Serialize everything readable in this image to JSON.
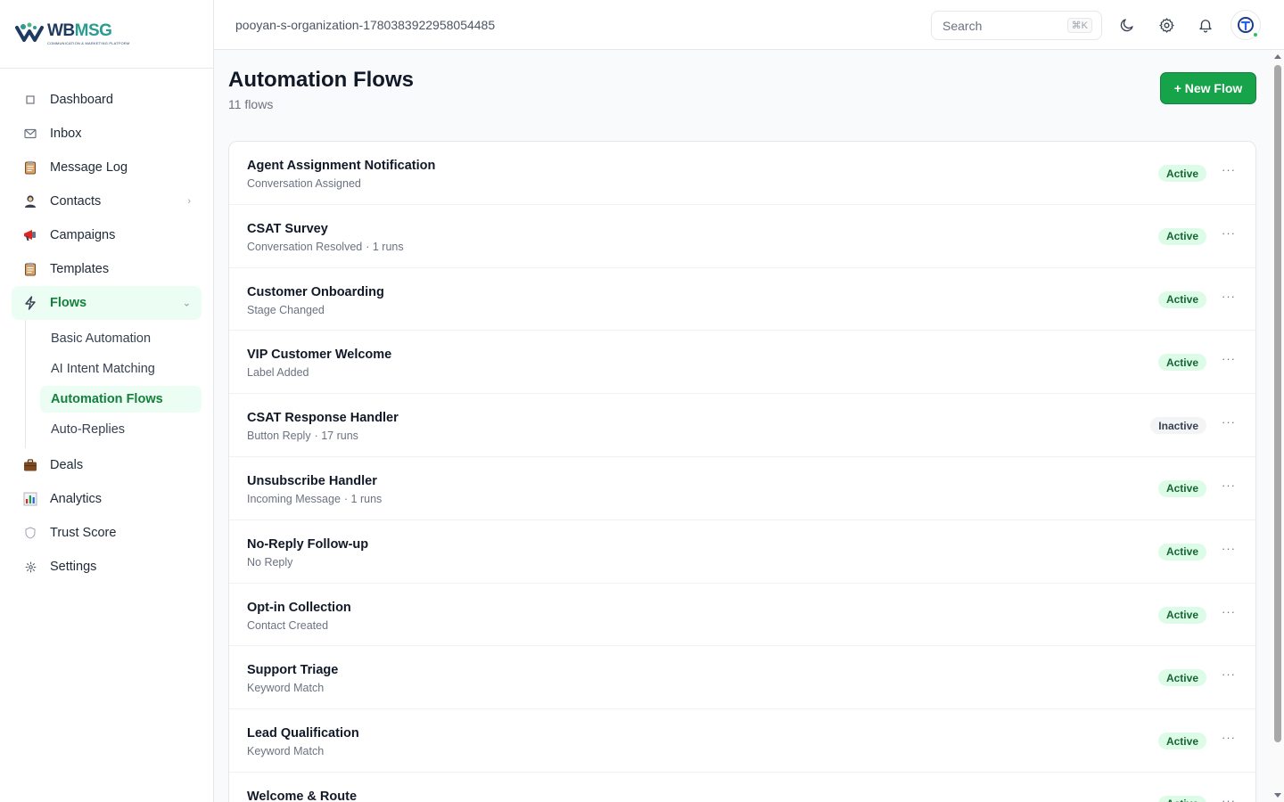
{
  "brand": {
    "name_part1": "WB",
    "name_part2": "MSG",
    "tagline": "COMMUNICATION & MARKETING PLATFORM"
  },
  "nav": {
    "dashboard": "Dashboard",
    "inbox": "Inbox",
    "message_log": "Message Log",
    "contacts": "Contacts",
    "campaigns": "Campaigns",
    "templates": "Templates",
    "flows": "Flows",
    "flows_sub": [
      "Basic Automation",
      "AI Intent Matching",
      "Automation Flows",
      "Auto-Replies"
    ],
    "deals": "Deals",
    "analytics": "Analytics",
    "trust_score": "Trust Score",
    "settings": "Settings"
  },
  "topbar": {
    "org": "pooyan-s-organization-1780383922958054485",
    "search_placeholder": "Search",
    "shortcut": "⌘K"
  },
  "page": {
    "title": "Automation Flows",
    "count": "11 flows",
    "new_button": "+ New Flow"
  },
  "flows": [
    {
      "name": "Agent Assignment Notification",
      "trigger": "Conversation Assigned",
      "runs": "",
      "status": "Active"
    },
    {
      "name": "CSAT Survey",
      "trigger": "Conversation Resolved",
      "runs": "· 1 runs",
      "status": "Active"
    },
    {
      "name": "Customer Onboarding",
      "trigger": "Stage Changed",
      "runs": "",
      "status": "Active"
    },
    {
      "name": "VIP Customer Welcome",
      "trigger": "Label Added",
      "runs": "",
      "status": "Active"
    },
    {
      "name": "CSAT Response Handler",
      "trigger": "Button Reply",
      "runs": "· 17 runs",
      "status": "Inactive"
    },
    {
      "name": "Unsubscribe Handler",
      "trigger": "Incoming Message",
      "runs": "· 1 runs",
      "status": "Active"
    },
    {
      "name": "No-Reply Follow-up",
      "trigger": "No Reply",
      "runs": "",
      "status": "Active"
    },
    {
      "name": "Opt-in Collection",
      "trigger": "Contact Created",
      "runs": "",
      "status": "Active"
    },
    {
      "name": "Support Triage",
      "trigger": "Keyword Match",
      "runs": "",
      "status": "Active"
    },
    {
      "name": "Lead Qualification",
      "trigger": "Keyword Match",
      "runs": "",
      "status": "Active"
    },
    {
      "name": "Welcome & Route",
      "trigger": "",
      "runs": "",
      "status": "Active"
    }
  ],
  "more_label": "···",
  "colors": {
    "accent": "#16a34a",
    "active_bg": "#dcfce7",
    "active_text": "#166534",
    "inactive_bg": "#f3f4f6"
  }
}
